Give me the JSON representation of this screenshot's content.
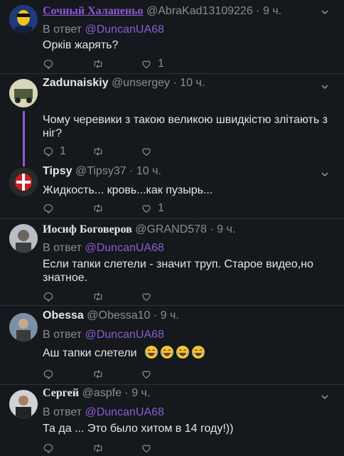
{
  "reply_prefix": "В ответ",
  "tweets": [
    {
      "name": "Сочный Халапеньо",
      "handle": "@AbraKad13109226",
      "time": "9 ч.",
      "reply_to": "@DuncanUA68",
      "text": "Орків жарять?",
      "reply_count": "",
      "retweet_count": "",
      "like_count": "1"
    },
    {
      "name": "Zadunaiskiy",
      "handle": "@unsergey",
      "time": "10 ч.",
      "reply_to": "",
      "text": "Чому черевики з такою великою швидкістю злітають з ніг?",
      "reply_count": "1",
      "retweet_count": "",
      "like_count": ""
    },
    {
      "name": "Tipsy",
      "handle": "@Tipsy37",
      "time": "10 ч.",
      "reply_to": "",
      "text": "Жидкость... кровь...как пузырь...",
      "reply_count": "",
      "retweet_count": "",
      "like_count": "1"
    },
    {
      "name": "Иосиф Боговеров",
      "handle": "@GRAND578",
      "time": "9 ч.",
      "reply_to": "@DuncanUA68",
      "text": "Если тапки слетели - значит труп. Старое видео,но знатное.",
      "reply_count": "",
      "retweet_count": "",
      "like_count": ""
    },
    {
      "name": "Obessa",
      "handle": "@Obessa10",
      "time": "9 ч.",
      "reply_to": "@DuncanUA68",
      "text": "Аш тапки слетели",
      "reply_count": "",
      "retweet_count": "",
      "like_count": ""
    },
    {
      "name": "Сергей",
      "handle": "@aspfe",
      "time": "9 ч.",
      "reply_to": "@DuncanUA68",
      "text": "Та да ... Это было хитом в 14 году!))",
      "reply_count": "",
      "retweet_count": "",
      "like_count": ""
    }
  ],
  "colors": {
    "background": "#15181c",
    "accent": "#8b5bd6",
    "muted": "#8a8d91"
  },
  "icons": [
    "reply-icon",
    "retweet-icon",
    "like-icon",
    "chevron-down-icon",
    "tears-of-joy-emoji"
  ]
}
